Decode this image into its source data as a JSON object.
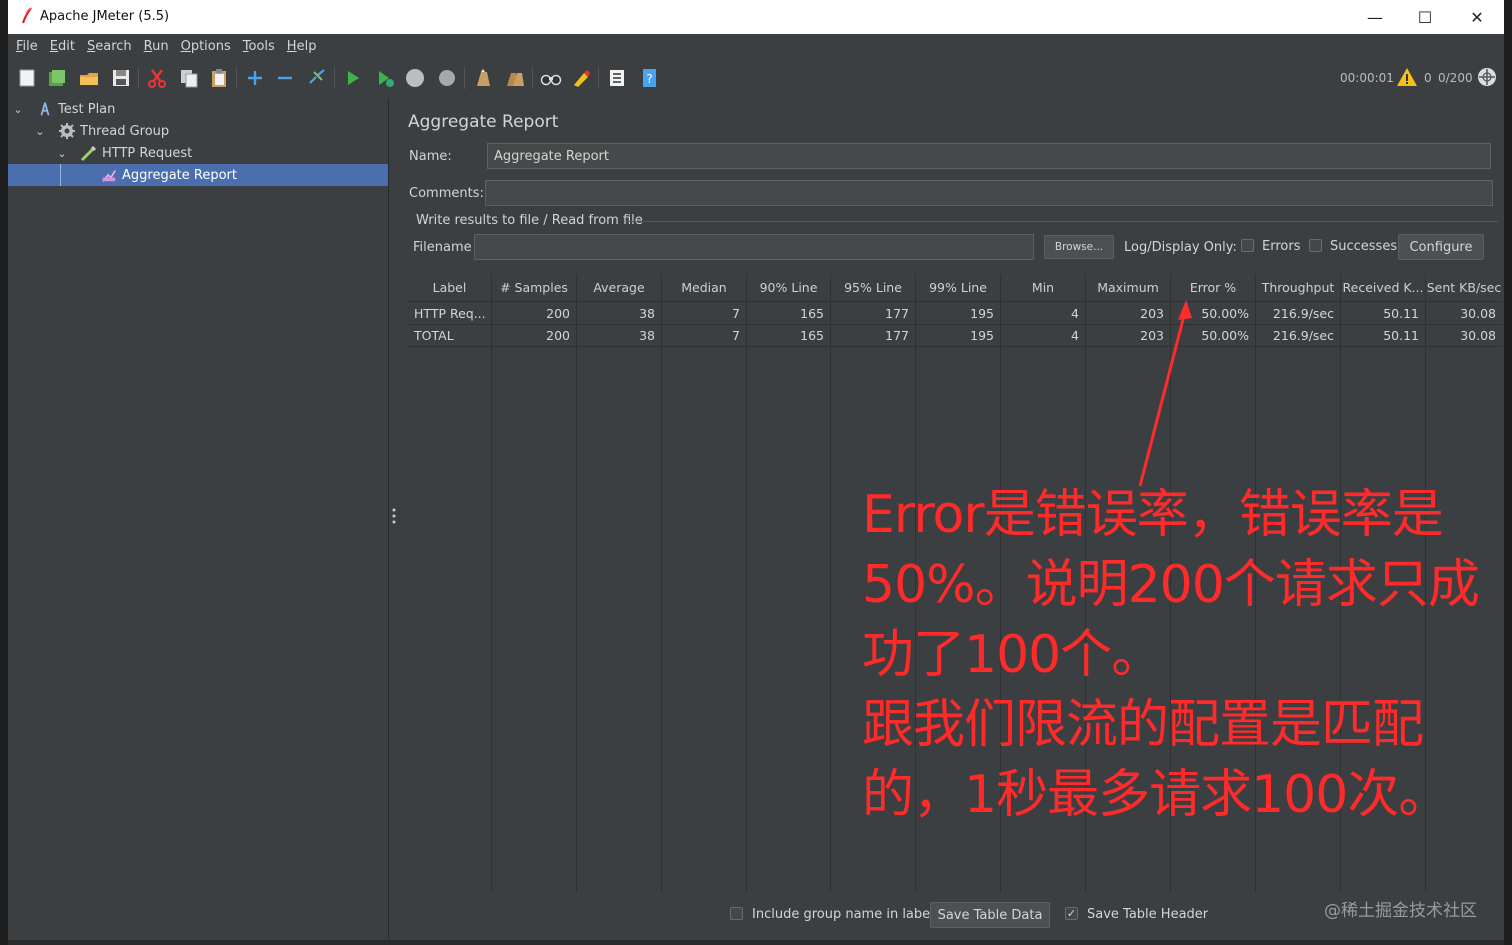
{
  "window": {
    "title": "Apache JMeter (5.5)",
    "controls": {
      "minimize": "—",
      "maximize": "☐",
      "close": "✕"
    }
  },
  "menu": [
    {
      "mnemonic": "F",
      "rest": "ile"
    },
    {
      "mnemonic": "E",
      "rest": "dit"
    },
    {
      "mnemonic": "S",
      "rest": "earch"
    },
    {
      "mnemonic": "R",
      "rest": "un"
    },
    {
      "mnemonic": "O",
      "rest": "ptions"
    },
    {
      "mnemonic": "T",
      "rest": "ools"
    },
    {
      "mnemonic": "H",
      "rest": "elp"
    }
  ],
  "toolbar": {
    "icons": [
      "new-icon",
      "templates-icon",
      "open-icon",
      "save-icon",
      "cut-icon",
      "copy-icon",
      "paste-icon",
      "expand-icon",
      "collapse-icon",
      "toggle-icon",
      "start-icon",
      "start-no-pause-icon",
      "stop-icon",
      "shutdown-icon",
      "clear-icon",
      "clear-all-icon",
      "search-icon",
      "reset-search-icon",
      "function-helper-icon",
      "help-icon"
    ]
  },
  "status": {
    "elapsed": "00:00:01",
    "errors": "0",
    "threads": "0/200"
  },
  "tree": [
    {
      "label": "Test Plan",
      "icon": "test-plan-icon",
      "level": 0,
      "expanded": true
    },
    {
      "label": "Thread Group",
      "icon": "gear-icon",
      "level": 1,
      "expanded": true
    },
    {
      "label": "HTTP Request",
      "icon": "pipette-icon",
      "level": 2,
      "expanded": true
    },
    {
      "label": "Aggregate Report",
      "icon": "chart-icon",
      "level": 3,
      "selected": true
    }
  ],
  "panel": {
    "title": "Aggregate Report",
    "name_label": "Name:",
    "name_value": "Aggregate Report",
    "comments_label": "Comments:",
    "comments_value": "",
    "file_section": "Write results to file / Read from file",
    "filename_label": "Filename",
    "filename_value": "",
    "browse": "Browse...",
    "log_display_only": "Log/Display Only:",
    "errors_label": "Errors",
    "successes_label": "Successes",
    "configure": "Configure"
  },
  "table": {
    "columns": [
      "Label",
      "# Samples",
      "Average",
      "Median",
      "90% Line",
      "95% Line",
      "99% Line",
      "Min",
      "Maximum",
      "Error %",
      "Throughput",
      "Received K...",
      "Sent KB/sec"
    ],
    "rows": [
      [
        "HTTP Req...",
        "200",
        "38",
        "7",
        "165",
        "177",
        "195",
        "4",
        "203",
        "50.00%",
        "216.9/sec",
        "50.11",
        "30.08"
      ],
      [
        "TOTAL",
        "200",
        "38",
        "7",
        "165",
        "177",
        "195",
        "4",
        "203",
        "50.00%",
        "216.9/sec",
        "50.11",
        "30.08"
      ]
    ]
  },
  "bottom": {
    "include_group": "Include group name in label?",
    "save_table_data": "Save Table Data",
    "save_table_header": "Save Table Header",
    "save_header_checked": "✓"
  },
  "annotation": {
    "lines": [
      "Error是错误率，错误率是",
      "50%。说明200个请求只成",
      "功了100个。",
      "跟我们限流的配置是匹配",
      "的，1秒最多请求100次。"
    ],
    "color": "#ff2a2a"
  },
  "watermark": "@稀土掘金技术社区"
}
